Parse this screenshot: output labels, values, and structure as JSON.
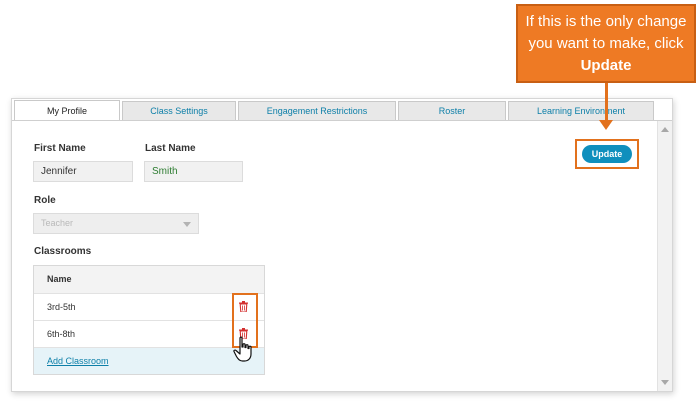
{
  "tabs": [
    {
      "label": "My Profile",
      "active": true
    },
    {
      "label": "Class Settings",
      "active": false
    },
    {
      "label": "Engagement Restrictions",
      "active": false
    },
    {
      "label": "Roster",
      "active": false
    },
    {
      "label": "Learning Environment",
      "active": false
    }
  ],
  "profile": {
    "first_name_label": "First Name",
    "first_name_value": "Jennifer",
    "last_name_label": "Last Name",
    "last_name_value": "Smith",
    "role_label": "Role",
    "role_value": "Teacher"
  },
  "classrooms": {
    "label": "Classrooms",
    "column_header": "Name",
    "rows": [
      {
        "name": "3rd-5th"
      },
      {
        "name": "6th-8th"
      }
    ],
    "add_label": "Add Classroom"
  },
  "update_label": "Update",
  "callout": {
    "text_before": "If this is the only change you want to make, click",
    "text_bold": "Update"
  },
  "colors": {
    "accent": "#0f8fbd",
    "highlight": "#e2711d",
    "callout_bg": "#ee7a24",
    "trash": "#d32f2f"
  }
}
